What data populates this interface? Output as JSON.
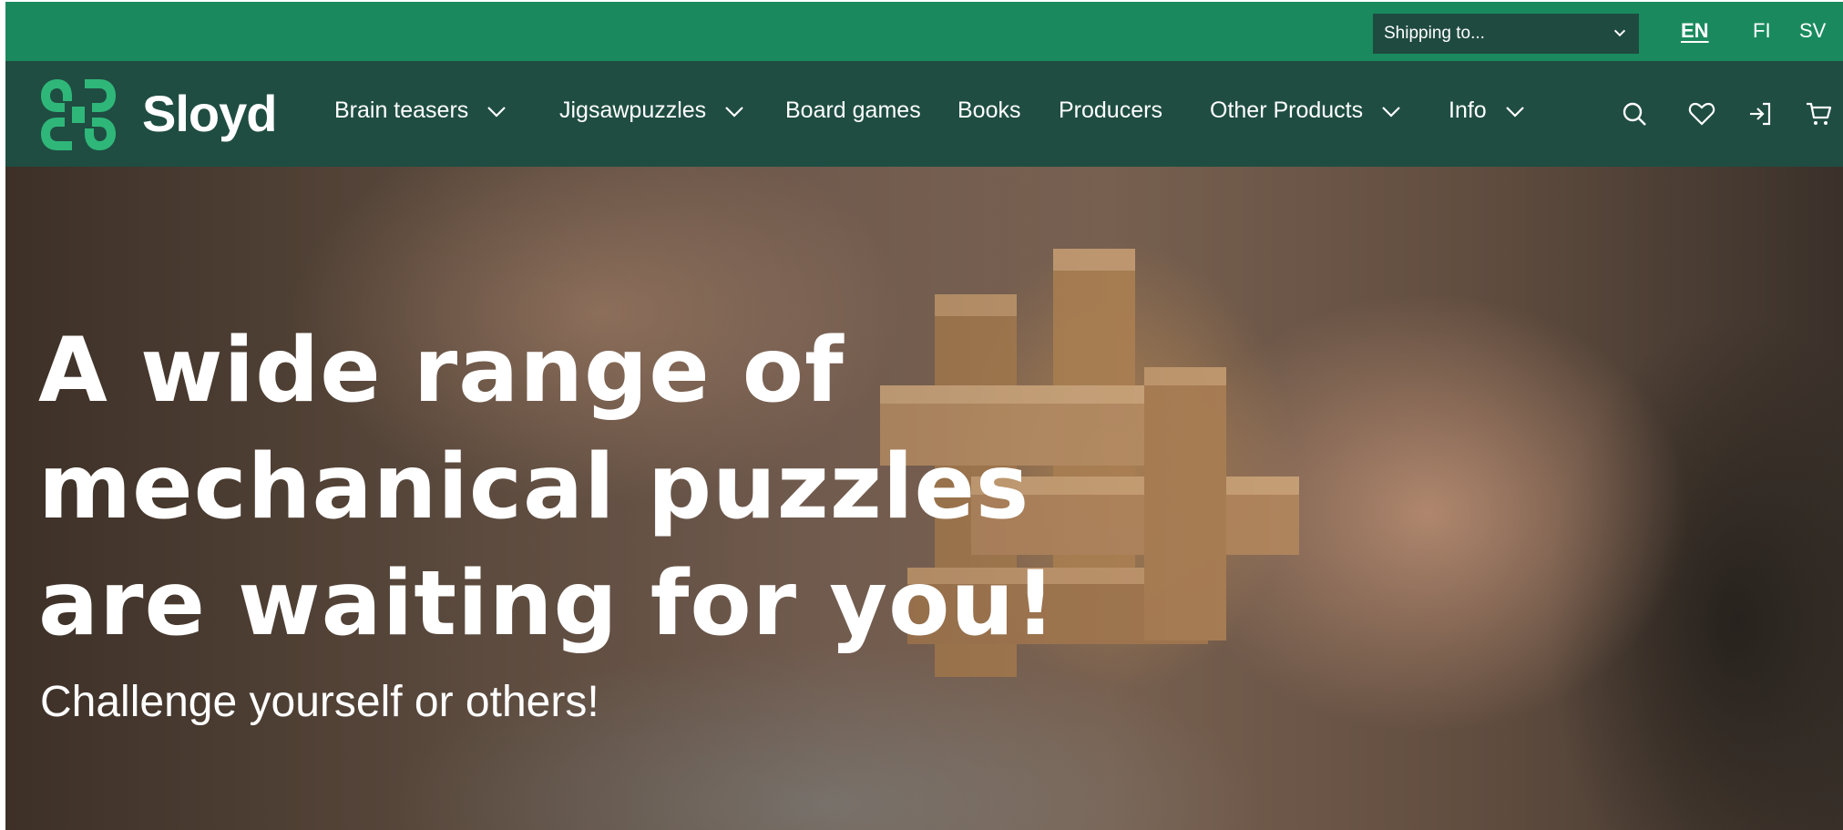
{
  "topbar": {
    "shipping_placeholder": "Shipping to...",
    "languages": [
      "EN",
      "FI",
      "SV"
    ],
    "active_language": "EN"
  },
  "brand": {
    "name": "Sloyd"
  },
  "nav": {
    "items": [
      {
        "label": "Brain teasers",
        "has_dropdown": true
      },
      {
        "label": "Jigsawpuzzles",
        "has_dropdown": true
      },
      {
        "label": "Board games",
        "has_dropdown": false
      },
      {
        "label": "Books",
        "has_dropdown": false
      },
      {
        "label": "Producers",
        "has_dropdown": false
      },
      {
        "label": "Other Products",
        "has_dropdown": true
      },
      {
        "label": "Info",
        "has_dropdown": true
      }
    ],
    "icons": [
      "search-icon",
      "heart-icon",
      "login-icon",
      "cart-icon"
    ]
  },
  "hero": {
    "title_line1": "A wide range of",
    "title_line2": "mechanical puzzles",
    "title_line3": "are waiting for you!",
    "subtitle": "Challenge yourself or others!"
  },
  "colors": {
    "topbar": "#1a8a5e",
    "nav": "#1f4d42",
    "logo": "#2fb779",
    "text": "#ffffff"
  }
}
